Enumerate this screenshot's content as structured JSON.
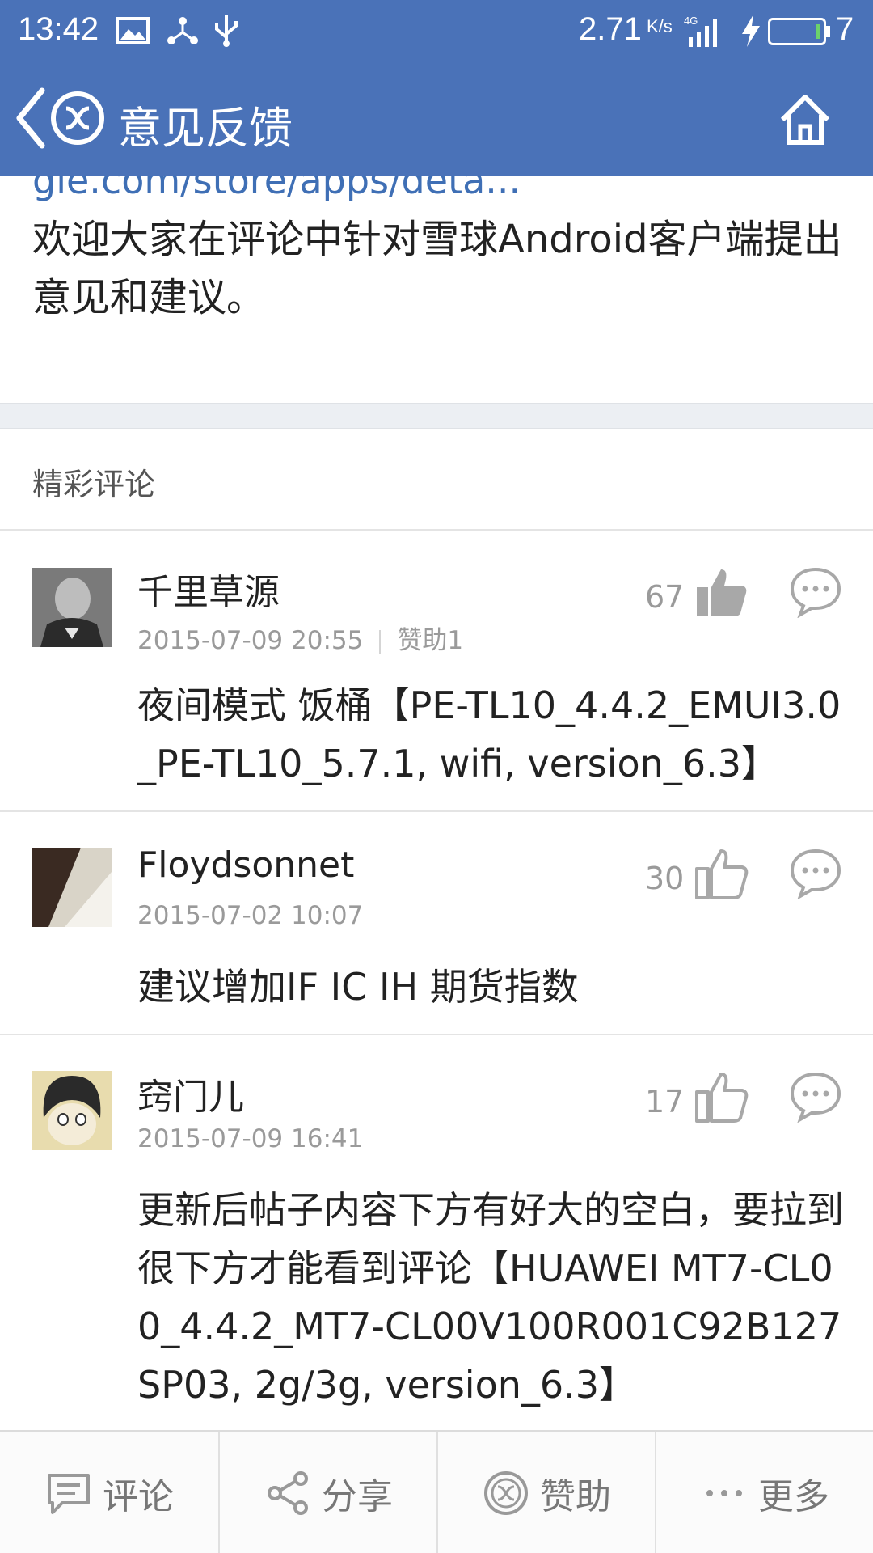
{
  "status_bar": {
    "time": "13:42",
    "speed": "2.71",
    "speed_unit": "K/s",
    "network": "4G",
    "battery": "7"
  },
  "header": {
    "title": "意见反馈"
  },
  "post": {
    "link_text": "gle.com/store/apps/deta...",
    "body": "欢迎大家在评论中针对雪球Android客户端提出意见和建议。"
  },
  "section": {
    "title": "精彩评论"
  },
  "comments": [
    {
      "name": "千里草源",
      "date": "2015-07-09 20:55",
      "extra": "赞助1",
      "likes": "67",
      "body": "夜间模式 饭桶【PE-TL10_4.4.2_EMUI3.0_PE-TL10_5.7.1, wifi, version_6.3】"
    },
    {
      "name": "Floydsonnet",
      "date": "2015-07-02 10:07",
      "likes": "30",
      "body": "建议增加IF IC IH 期货指数"
    },
    {
      "name": "窍门儿",
      "date": "2015-07-09 16:41",
      "likes": "17",
      "body": "更新后帖子内容下方有好大的空白，要拉到很下方才能看到评论【HUAWEI MT7-CL00_4.4.2_MT7-CL00V100R001C92B127SP03, 2g/3g, version_6.3】"
    }
  ],
  "bottom_bar": {
    "comment": "评论",
    "share": "分享",
    "sponsor": "赞助",
    "more": "更多"
  },
  "colors": {
    "primary": "#4a72b8",
    "link": "#3f6fb5",
    "muted": "#9a9a9a"
  }
}
